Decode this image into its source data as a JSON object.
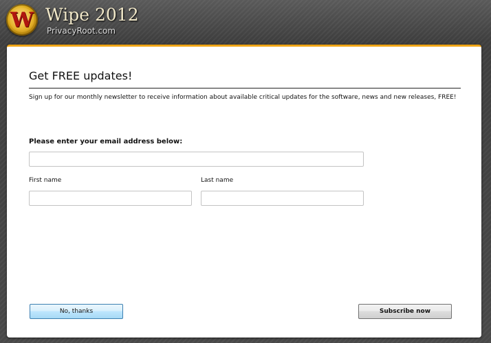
{
  "app": {
    "logo_letter": "W",
    "title": "Wipe 2012",
    "subtitle": "PrivacyRoot.com",
    "accent_color": "#f0a515"
  },
  "panel": {
    "title": "Get FREE updates!",
    "intro": "Sign up for our monthly newsletter to receive information about available critical updates for the software, news and new releases, FREE!"
  },
  "form": {
    "email_label": "Please enter your email address below:",
    "email_value": "",
    "first_name_label": "First name",
    "first_name_value": "",
    "last_name_label": "Last name",
    "last_name_value": ""
  },
  "buttons": {
    "no_thanks": "No, thanks",
    "subscribe": "Subscribe now"
  }
}
